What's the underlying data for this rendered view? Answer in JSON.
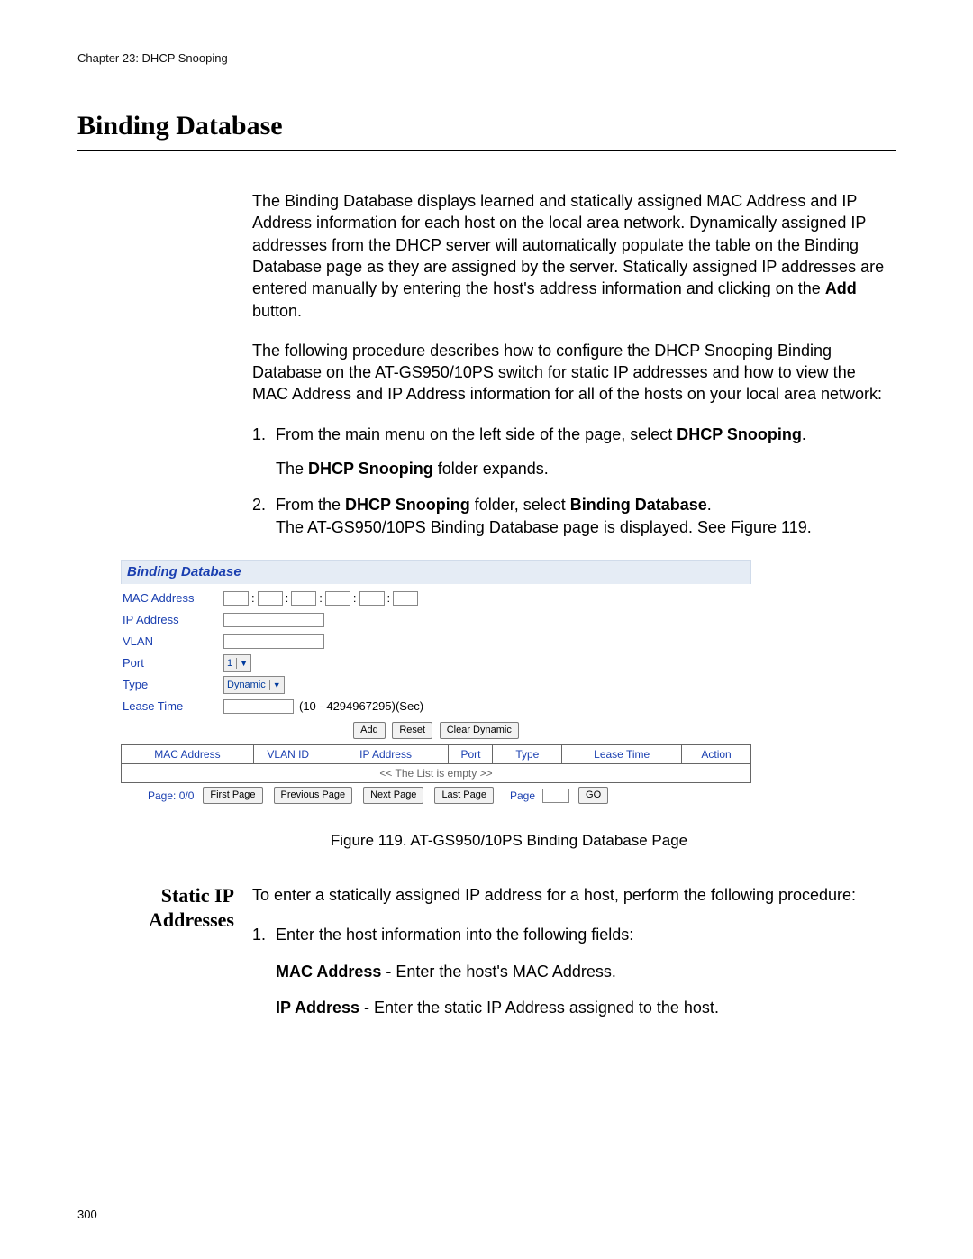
{
  "chapter_line": "Chapter 23: DHCP Snooping",
  "h1": "Binding Database",
  "intro_p1_a": "The Binding Database displays learned and statically assigned MAC Address and IP Address information for each host on the local area network. Dynamically assigned IP addresses from the DHCP server will automatically populate the table on the Binding Database page as they are assigned by the server. Statically assigned IP addresses are entered manually by entering the host's address information and clicking on the ",
  "intro_p1_bold": "Add",
  "intro_p1_b": " button.",
  "intro_p2": "The following procedure describes how to configure the DHCP Snooping Binding Database on the AT-GS950/10PS switch for static IP addresses and how to view the MAC Address and IP Address information for all of the hosts on your local area network:",
  "step1_a": "From the main menu on the left side of the page, select ",
  "step1_b1": "DHCP Snooping",
  "step1_c": ".",
  "step1_sub_a": "The ",
  "step1_sub_b": "DHCP Snooping",
  "step1_sub_c": " folder expands.",
  "step2_a": "From the ",
  "step2_b1": "DHCP Snooping",
  "step2_c": " folder, select ",
  "step2_b2": "Binding Database",
  "step2_d": ".",
  "step2_sub": "The AT-GS950/10PS Binding Database page is displayed. See Figure 119.",
  "figure": {
    "title": "Binding Database",
    "labels": {
      "mac": "MAC Address",
      "ip": "IP Address",
      "vlan": "VLAN",
      "port": "Port",
      "type": "Type",
      "lease": "Lease Time"
    },
    "port_value": "1",
    "type_value": "Dynamic",
    "lease_hint": "(10 - 4294967295)(Sec)",
    "buttons": {
      "add": "Add",
      "reset": "Reset",
      "clear": "Clear Dynamic"
    },
    "table_headers": [
      "MAC Address",
      "VLAN ID",
      "IP Address",
      "Port",
      "Type",
      "Lease Time",
      "Action"
    ],
    "empty_text": "<< The List is empty >>",
    "pager": {
      "page_info": "Page: 0/0",
      "first": "First Page",
      "prev": "Previous Page",
      "next": "Next Page",
      "last": "Last Page",
      "page_label": "Page",
      "go": "GO"
    }
  },
  "figure_caption": "Figure 119. AT-GS950/10PS Binding Database Page",
  "section2_title_l1": "Static IP",
  "section2_title_l2": "Addresses",
  "sec2_p1": "To enter a statically assigned IP address for a host, perform the following procedure:",
  "sec2_step1": "Enter the host information into the following fields:",
  "sec2_mac_b": "MAC Address",
  "sec2_mac_t": " - Enter the host's MAC Address.",
  "sec2_ip_b": "IP Address",
  "sec2_ip_t": " - Enter the static IP Address assigned to the host.",
  "page_number": "300"
}
